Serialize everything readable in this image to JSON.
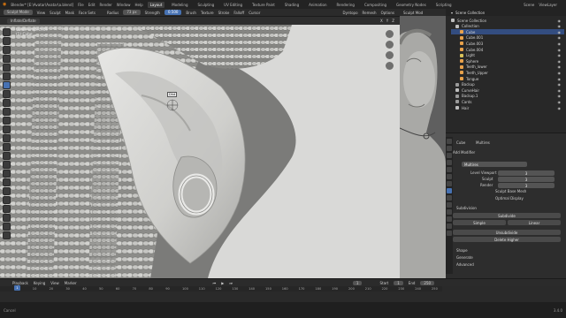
{
  "topbar": {
    "title": "Blender* [E:\\Avatar\\Avatar\\a.blend]",
    "menus": [
      "File",
      "Edit",
      "Render",
      "Window",
      "Help"
    ],
    "workspaces": [
      "Layout",
      "Modeling",
      "Sculpting",
      "UV Editing",
      "Texture Paint",
      "Shading",
      "Animation",
      "Rendering",
      "Compositing",
      "Geometry Nodes",
      "Scripting"
    ],
    "active_workspace": "Layout",
    "scene": "Scene",
    "view_layer": "ViewLayer"
  },
  "tool_header": {
    "mode": "Sculpt Mode",
    "menus": [
      "View",
      "Sculpt",
      "Mask",
      "Face Sets"
    ],
    "radius_label": "Radius",
    "radius_value": "73 px",
    "strength_label": "Strength",
    "strength_value": "0.500",
    "dropdowns": [
      "Brush",
      "Texture",
      "Stroke",
      "Falloff",
      "Cursor"
    ],
    "right_items": [
      "Dyntopo",
      "Remesh",
      "Options"
    ]
  },
  "viewport_header": {
    "brush": "Inflate/Deflate",
    "right_items": [
      "X",
      "Y",
      "Z"
    ]
  },
  "viewport": {
    "view_name": "User Perspective",
    "object_name": "(1) Cube",
    "cursor_tooltip": "Dhd"
  },
  "ref_panel": {
    "label": "Sculpt Mod"
  },
  "outliner": {
    "title": "Scene Collection",
    "rows": [
      {
        "label": "Scene Collection",
        "indent": 0,
        "selected": false,
        "color": "#bdbdbd"
      },
      {
        "label": "Collection",
        "indent": 1,
        "selected": false,
        "color": "#bdbdbd"
      },
      {
        "label": "Cube",
        "indent": 2,
        "selected": true,
        "color": "#e8a14a"
      },
      {
        "label": "Cube.001",
        "indent": 2,
        "selected": false,
        "color": "#e8a14a"
      },
      {
        "label": "Cube.003",
        "indent": 2,
        "selected": false,
        "color": "#e8a14a"
      },
      {
        "label": "Cube.004",
        "indent": 2,
        "selected": false,
        "color": "#e8a14a"
      },
      {
        "label": "Light",
        "indent": 2,
        "selected": false,
        "color": "#d7c15a"
      },
      {
        "label": "Sphere",
        "indent": 2,
        "selected": false,
        "color": "#e8a14a"
      },
      {
        "label": "Teeth_lower",
        "indent": 2,
        "selected": false,
        "color": "#e8a14a"
      },
      {
        "label": "Teeth_Upper",
        "indent": 2,
        "selected": false,
        "color": "#e8a14a"
      },
      {
        "label": "Tongue",
        "indent": 2,
        "selected": false,
        "color": "#e8a14a"
      },
      {
        "label": "Backup",
        "indent": 1,
        "selected": false,
        "color": "#9a9a9a"
      },
      {
        "label": "CurveHair",
        "indent": 1,
        "selected": false,
        "color": "#bdbdbd"
      },
      {
        "label": "Backup.1",
        "indent": 1,
        "selected": false,
        "color": "#9a9a9a"
      },
      {
        "label": "Cards",
        "indent": 1,
        "selected": false,
        "color": "#9a9a9a"
      },
      {
        "label": "Hair",
        "indent": 1,
        "selected": false,
        "color": "#bdbdbd"
      }
    ]
  },
  "properties": {
    "object": "Cube",
    "modifier_type": "Multires",
    "add_modifier": "Add Modifier",
    "modifier_name": "Multires",
    "level_viewport_label": "Level Viewport",
    "level_viewport_value": "3",
    "sculpt_label": "Sculpt",
    "sculpt_value": "3",
    "render_label": "Render",
    "render_value": "3",
    "sculpt_base_mesh": "Sculpt Base Mesh",
    "optimal_display": "Optimal Display",
    "subdivision_section": "Subdivision",
    "subdivide_btn": "Subdivide",
    "simple_btn": "Simple",
    "linear_btn": "Linear",
    "unsubdivide_btn": "Unsubdivide",
    "delete_higher_btn": "Delete Higher",
    "sections": [
      "Shape",
      "Generate",
      "Advanced"
    ]
  },
  "timeline": {
    "menus": [
      "Playback",
      "Keying",
      "View",
      "Marker"
    ],
    "current_frame": "1",
    "start_label": "Start",
    "start_value": "1",
    "end_label": "End",
    "end_value": "250",
    "ticks": [
      "0",
      "10",
      "20",
      "30",
      "40",
      "50",
      "60",
      "70",
      "80",
      "90",
      "100",
      "110",
      "120",
      "130",
      "140",
      "150",
      "160",
      "170",
      "180",
      "190",
      "200",
      "210",
      "220",
      "230",
      "240",
      "250"
    ]
  },
  "statusbar": {
    "left": "Cancel",
    "version": "3.4.0"
  }
}
